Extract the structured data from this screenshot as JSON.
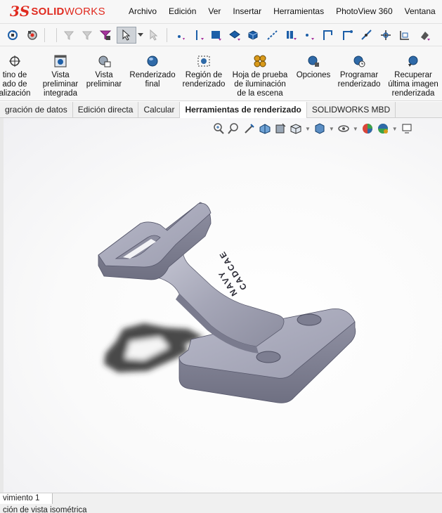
{
  "app": {
    "brand_prefix": "3S",
    "brand_bold": "SOLID",
    "brand_light": "WORKS"
  },
  "menu": [
    "Archivo",
    "Edición",
    "Ver",
    "Insertar",
    "Herramientas",
    "PhotoView 360",
    "Ventana",
    "?"
  ],
  "toolbar": {
    "icons": [
      "rebuild-options-icon",
      "options-icon",
      "filter-icon",
      "filter-selection-icon",
      "filter-active-icon",
      "select-arrow-icon",
      "select-dropdown-icon",
      "select-disabled-icon",
      "point-icon",
      "axis-icon",
      "plane-icon",
      "face-icon",
      "solid-body-icon",
      "line-icon",
      "vertex-icon",
      "sketch-point-icon",
      "sketch-segment-icon",
      "edge-icon",
      "spline-icon",
      "midpoint-icon",
      "coordinate-icon",
      "dimension-icon"
    ]
  },
  "ribbon": {
    "items": [
      {
        "id": "partial-destino",
        "icon": "destination-icon",
        "label": "tino de\nado de\nalización"
      },
      {
        "id": "integrated-preview",
        "icon": "integrated-preview-icon",
        "label": "Vista\npreliminar\nintegrada"
      },
      {
        "id": "preview",
        "icon": "preview-window-icon",
        "label": "Vista\npreliminar"
      },
      {
        "id": "final-render",
        "icon": "final-render-icon",
        "label": "Renderizado\nfinal"
      },
      {
        "id": "render-region",
        "icon": "render-region-icon",
        "label": "Región de\nrenderizado"
      },
      {
        "id": "lighting-sheet",
        "icon": "lighting-sheet-icon",
        "label": "Hoja de prueba\nde iluminación\nde la escena"
      },
      {
        "id": "options",
        "icon": "render-options-icon",
        "label": "Opciones"
      },
      {
        "id": "schedule",
        "icon": "schedule-render-icon",
        "label": "Programar\nrenderizado"
      },
      {
        "id": "recover",
        "icon": "recover-image-icon",
        "label": "Recuperar\núltima imagen\nrenderizada"
      }
    ]
  },
  "tabs": [
    {
      "label": "gración de datos",
      "active": false
    },
    {
      "label": "Edición directa",
      "active": false
    },
    {
      "label": "Calcular",
      "active": false
    },
    {
      "label": "Herramientas de renderizado",
      "active": true
    },
    {
      "label": "SOLIDWORKS MBD",
      "active": false
    }
  ],
  "heads_up": [
    "zoom-fit-icon",
    "zoom-area-icon",
    "previous-view-icon",
    "section-view-icon",
    "dynamic-annotation-icon",
    "view-orientation-icon",
    "display-style-icon",
    "hide-show-icon",
    "edit-appearance-icon",
    "scene-icon",
    "view-settings-icon"
  ],
  "model": {
    "engraving": [
      "NAVY",
      "CADCAE"
    ],
    "colors": {
      "body": "#9a9bae",
      "body_dark": "#6f7082",
      "body_light": "#c5c6d4",
      "shadow": "#2b2b2b"
    }
  },
  "bottom_tab": "vimiento 1",
  "status": "ción de vista isométrica"
}
